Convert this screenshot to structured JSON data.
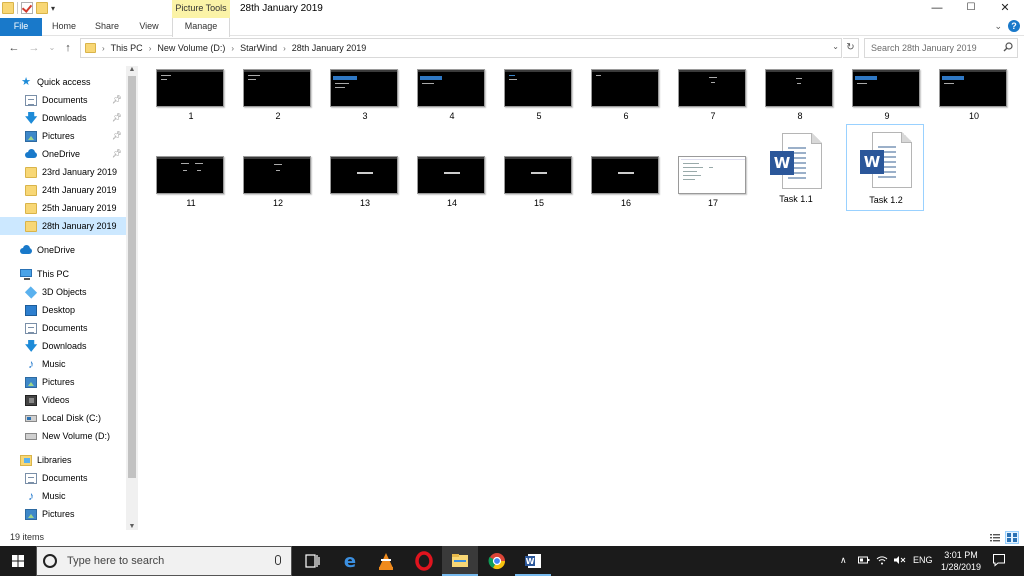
{
  "window": {
    "title": "28th January 2019",
    "context_tab": "Picture Tools",
    "controls": {
      "minimize": "—",
      "maximize": "☐",
      "close": "✕"
    }
  },
  "ribbon": {
    "tabs": [
      {
        "label": "File"
      },
      {
        "label": "Home"
      },
      {
        "label": "Share"
      },
      {
        "label": "View"
      },
      {
        "label": "Manage"
      }
    ]
  },
  "address": {
    "crumbs": [
      "This PC",
      "New Volume (D:)",
      "StarWind",
      "28th January 2019"
    ],
    "search_placeholder": "Search 28th January 2019"
  },
  "nav": {
    "quick_access": {
      "label": "Quick access",
      "items": [
        {
          "label": "Documents",
          "pinned": true
        },
        {
          "label": "Downloads",
          "pinned": true
        },
        {
          "label": "Pictures",
          "pinned": true
        },
        {
          "label": "OneDrive",
          "pinned": true
        },
        {
          "label": "23rd January 2019"
        },
        {
          "label": "24th January 2019"
        },
        {
          "label": "25th January 2019"
        },
        {
          "label": "28th January 2019",
          "selected": true
        }
      ]
    },
    "onedrive": "OneDrive",
    "this_pc": {
      "label": "This PC",
      "items": [
        "3D Objects",
        "Desktop",
        "Documents",
        "Downloads",
        "Music",
        "Pictures",
        "Videos",
        "Local Disk (C:)",
        "New Volume (D:)"
      ]
    },
    "libraries": {
      "label": "Libraries",
      "items": [
        "Documents",
        "Music",
        "Pictures"
      ]
    }
  },
  "files": [
    {
      "name": "1",
      "kind": "screenshot"
    },
    {
      "name": "2",
      "kind": "screenshot"
    },
    {
      "name": "3",
      "kind": "screenshot"
    },
    {
      "name": "4",
      "kind": "screenshot"
    },
    {
      "name": "5",
      "kind": "screenshot"
    },
    {
      "name": "6",
      "kind": "screenshot"
    },
    {
      "name": "7",
      "kind": "screenshot"
    },
    {
      "name": "8",
      "kind": "screenshot"
    },
    {
      "name": "9",
      "kind": "screenshot"
    },
    {
      "name": "10",
      "kind": "screenshot"
    },
    {
      "name": "11",
      "kind": "screenshot"
    },
    {
      "name": "12",
      "kind": "screenshot"
    },
    {
      "name": "13",
      "kind": "screenshot"
    },
    {
      "name": "14",
      "kind": "screenshot"
    },
    {
      "name": "15",
      "kind": "screenshot"
    },
    {
      "name": "16",
      "kind": "screenshot"
    },
    {
      "name": "17",
      "kind": "screenshot-light"
    },
    {
      "name": "Task 1.1",
      "kind": "word"
    },
    {
      "name": "Task 1.2",
      "kind": "word",
      "selected": true
    }
  ],
  "status": {
    "item_count": "19 items"
  },
  "taskbar": {
    "search_placeholder": "Type here to search",
    "apps": [
      "task-view",
      "edge",
      "vlc",
      "opera",
      "file-explorer",
      "chrome",
      "word"
    ],
    "language": "ENG",
    "time": "3:01 PM",
    "date": "1/28/2019"
  },
  "colors": {
    "accent": "#1979ca",
    "selection": "#cce8ff",
    "picture_tools": "#fbf3a7",
    "taskbar": "#1b1b1b",
    "word_blue": "#2b579a"
  }
}
